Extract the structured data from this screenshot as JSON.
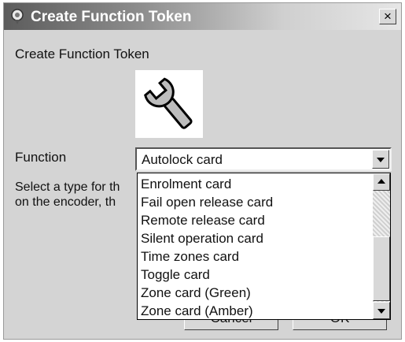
{
  "window": {
    "title": "Create Function Token",
    "close_glyph": "×",
    "icon": "token-icon"
  },
  "dialog": {
    "heading": "Create Function Token",
    "tool_icon": "wrench-icon",
    "function_label": "Function",
    "function_value": "Autolock card",
    "description_line1": "Select a type for th",
    "description_line2": "on the encoder, th"
  },
  "dropdown": {
    "options": [
      "Enrolment card",
      "Fail open release card",
      "Remote release card",
      "Silent operation card",
      "Time zones card",
      "Toggle card",
      "Zone card (Green)",
      "Zone card (Amber)"
    ]
  },
  "buttons": {
    "cancel_label": "Cancel",
    "ok_label": "OK"
  },
  "colors": {
    "titlebar_start": "#5c5c5c",
    "titlebar_end": "#e6e6e6",
    "window_bg": "#d4d4d4"
  }
}
